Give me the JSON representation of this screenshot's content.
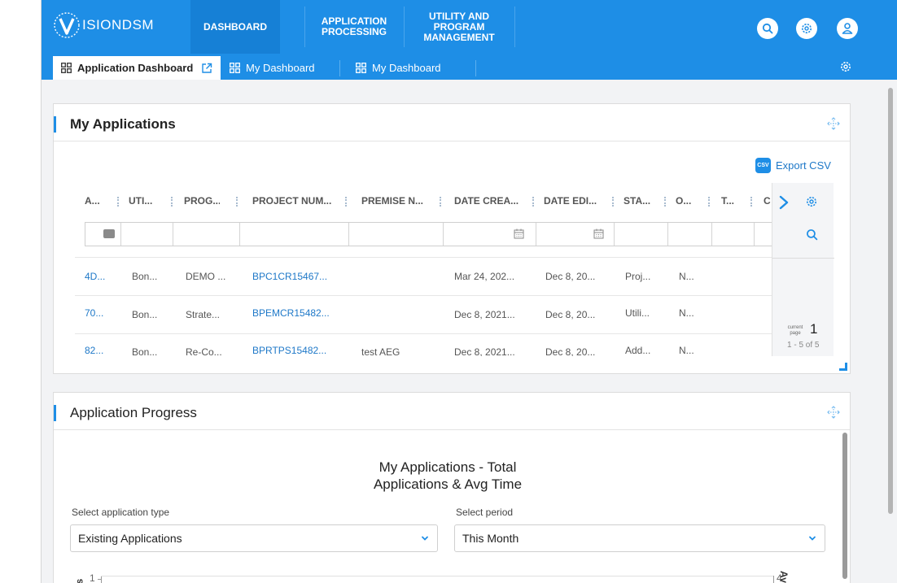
{
  "app": {
    "logo_letter": "V",
    "logo_text": "ISION",
    "logo_suffix": "DSM"
  },
  "topnav": {
    "items": [
      {
        "label": "DASHBOARD"
      },
      {
        "label": "APPLICATION\nPROCESSING"
      },
      {
        "label": "UTILITY AND\nPROGRAM\nMANAGEMENT"
      }
    ],
    "icons": [
      "search-icon",
      "gear-icon",
      "user-icon"
    ]
  },
  "tabs": {
    "items": [
      {
        "label": "Application Dashboard",
        "icon": "dashboard-icon",
        "extra_icon": "external-link-icon"
      },
      {
        "label": "My Dashboard",
        "icon": "dashboard-icon"
      },
      {
        "label": "My Dashboard",
        "icon": "dashboard-icon"
      }
    ],
    "settings_icon": "gear-icon"
  },
  "my_applications": {
    "title": "My Applications",
    "export_label": "Export CSV",
    "export_badge": "CSV",
    "columns": [
      "A...",
      "UTI...",
      "PROG...",
      "PROJECT NUM...",
      "PREMISE N...",
      "DATE CREA...",
      "DATE EDI...",
      "STA...",
      "O...",
      "T...",
      "C"
    ],
    "rows": [
      {
        "app": "4D...",
        "utility": "Bon...",
        "program": "DEMO ...",
        "project": "BPC1CR15467...",
        "premise": "",
        "created": "Mar 24, 202...",
        "edited": "Dec 8, 20...",
        "status": "Proj...",
        "owner": "N..."
      },
      {
        "app": "70...",
        "utility": "Bon...",
        "program": "Strate...",
        "project": "BPEMCR15482...",
        "premise": "",
        "created": "Dec 8, 2021...",
        "edited": "Dec 8, 20...",
        "status": "Utili...",
        "owner": "N..."
      },
      {
        "app": "82...",
        "utility": "Bon...",
        "program": "Re-Co...",
        "project": "BPRTPS15482...",
        "premise": "test AEG",
        "created": "Dec 8, 2021...",
        "edited": "Dec 8, 20...",
        "status": "Add...",
        "owner": "N..."
      }
    ],
    "pager": {
      "label": "current page",
      "page": "1",
      "range": "1 - 5 of 5"
    }
  },
  "application_progress": {
    "title": "Application Progress",
    "chart_title_line1": "My Applications - Total",
    "chart_title_line2": "Applications & Avg Time",
    "type_label": "Select application type",
    "type_value": "Existing Applications",
    "period_label": "Select period",
    "period_value": "This Month",
    "axis_left_tick": "1",
    "axis_right_tick": "4",
    "axis_left_label_partial": "s",
    "axis_right_label_partial": "Avg"
  },
  "colors": {
    "brand_blue": "#1e8ee6",
    "link_blue": "#1e78c8"
  }
}
